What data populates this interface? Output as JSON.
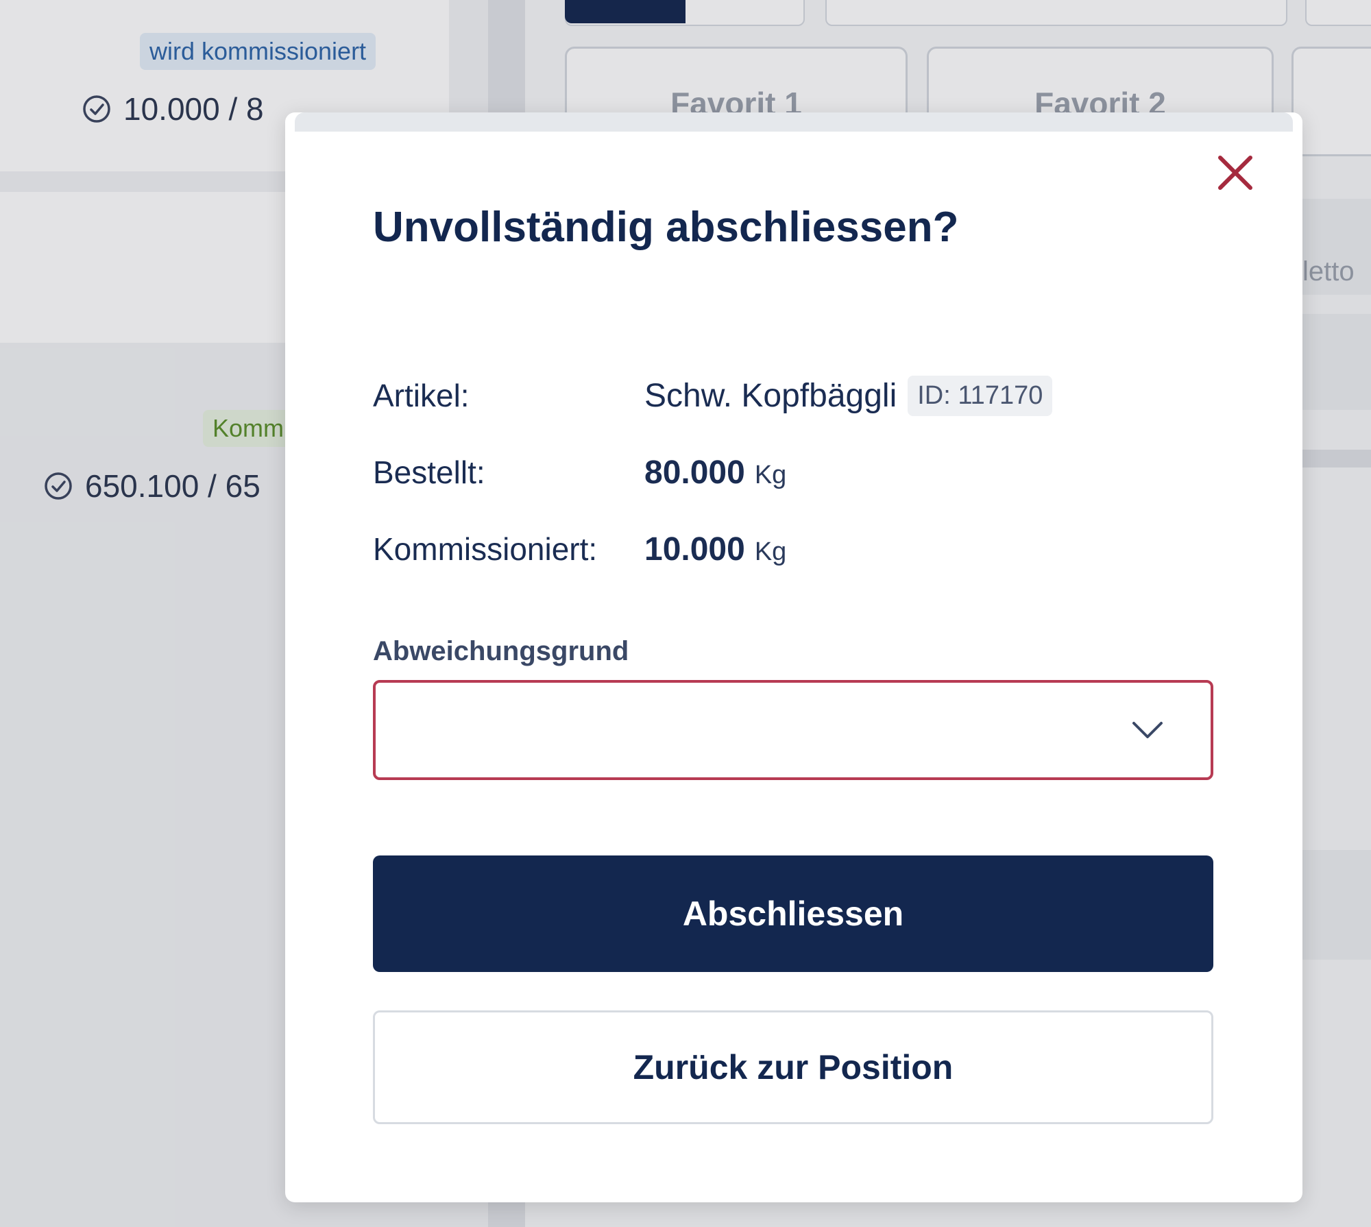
{
  "background": {
    "orders": [
      {
        "status": "wird kommissioniert",
        "quantity": "10.000 / 8"
      },
      {
        "status": "Komm",
        "quantity": "650.100 / 65"
      }
    ],
    "favorites": [
      "Favorit 1",
      "Favorit 2"
    ],
    "partial_label": "letto"
  },
  "modal": {
    "title": "Unvollständig abschliessen?",
    "details": {
      "artikel_label": "Artikel:",
      "artikel_name": "Schw. Kopfbäggli",
      "artikel_id": "ID: 117170",
      "bestellt_label": "Bestellt:",
      "bestellt_value": "80.000",
      "bestellt_unit": "Kg",
      "kommissioniert_label": "Kommissioniert:",
      "kommissioniert_value": "10.000",
      "kommissioniert_unit": "Kg"
    },
    "reason_field": {
      "label": "Abweichungsgrund",
      "value": "",
      "state": "error",
      "icon": "chevron-down-icon"
    },
    "buttons": {
      "confirm_label": "Abschliessen",
      "back_label": "Zurück zur Position"
    },
    "close_icon": "close-icon"
  },
  "colors": {
    "primary": "#13274f",
    "error_border": "#b73b53",
    "close": "#a52a3e",
    "status_blue": "#2c64a8",
    "status_green": "#5a8f2a"
  }
}
